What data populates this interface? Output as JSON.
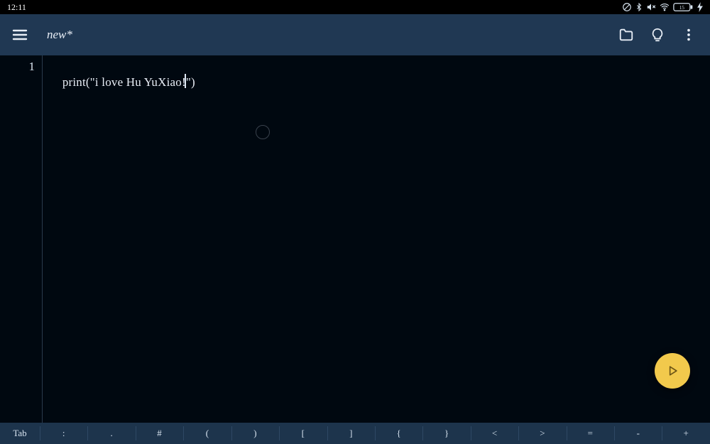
{
  "statusbar": {
    "time": "12:11",
    "battery_percent": "15"
  },
  "appbar": {
    "title": "new*",
    "icons": {
      "menu": "hamburger-icon",
      "folder": "folder-icon",
      "bulb": "lightbulb-icon",
      "more": "more-vert-icon"
    }
  },
  "editor": {
    "lines": [
      {
        "num": "1",
        "text": "print(\"i love Hu YuXiao!\")"
      }
    ],
    "caret_after_index": 24
  },
  "fab": {
    "label": "Run"
  },
  "keyrow": [
    "Tab",
    ":",
    ".",
    "#",
    "(",
    ")",
    "[",
    "]",
    "{",
    "}",
    "<",
    ">",
    "=",
    "-",
    "+"
  ],
  "colors": {
    "appbar": "#203853",
    "bg": "#000810",
    "accent": "#f2c94c"
  }
}
